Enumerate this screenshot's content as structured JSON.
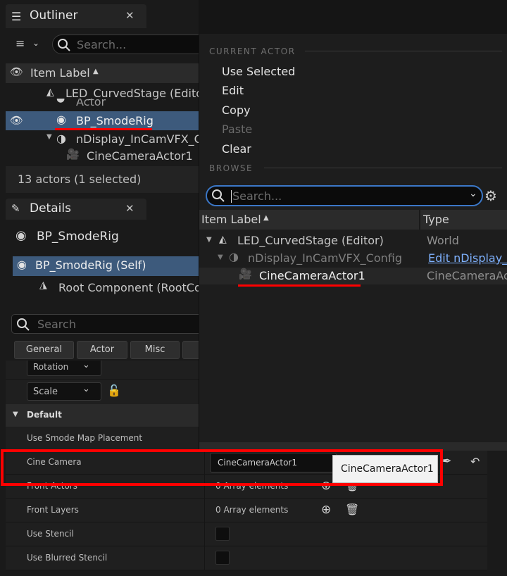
{
  "outliner": {
    "tab_title": "Outliner",
    "search_placeholder": "Search...",
    "column_label": "Item Label",
    "rows": [
      "LED_CurvedStage (Editor)",
      "Actor",
      "BP_SmodeRig",
      "nDisplay_InCamVFX_Config",
      "CineCameraActor1"
    ],
    "status": "13 actors (1 selected)"
  },
  "details": {
    "tab_title": "Details",
    "actor_name": "BP_SmodeRig",
    "self_item": "BP_SmodeRig (Self)",
    "root_component": "Root Component (RootCo",
    "search_placeholder": "Search",
    "categories": [
      "General",
      "Actor",
      "Misc"
    ],
    "rotation": "Rotation",
    "scale": "Scale",
    "section": "Default",
    "props": [
      {
        "label": "Use Smode Map Placement",
        "value": ""
      },
      {
        "label": "Cine Camera",
        "value": "CineCameraActor1"
      },
      {
        "label": "Front Actors",
        "value": "0 Array elements"
      },
      {
        "label": "Front Layers",
        "value": "0 Array elements"
      },
      {
        "label": "Use Stencil",
        "value": ""
      },
      {
        "label": "Use Blurred Stencil",
        "value": ""
      }
    ],
    "tooltip": "CineCameraActor1"
  },
  "popup": {
    "current_actor_title": "CURRENT ACTOR",
    "menu": [
      {
        "label": "Use Selected",
        "enabled": true
      },
      {
        "label": "Edit",
        "enabled": true
      },
      {
        "label": "Copy",
        "enabled": true
      },
      {
        "label": "Paste",
        "enabled": false
      },
      {
        "label": "Clear",
        "enabled": true
      }
    ],
    "browse_title": "BROWSE",
    "search_placeholder": "Search...",
    "col_label": "Item Label",
    "col_type": "Type",
    "tree": [
      {
        "label": "LED_CurvedStage (Editor)",
        "type": "World"
      },
      {
        "label": "nDisplay_InCamVFX_Config",
        "type": "Edit nDisplay_I"
      },
      {
        "label": "CineCameraActor1",
        "type": "CineCameraAc"
      }
    ]
  },
  "colors": {
    "selection": "#3d5a7c",
    "highlight": "#ff0000",
    "link": "#7fb2ff"
  }
}
